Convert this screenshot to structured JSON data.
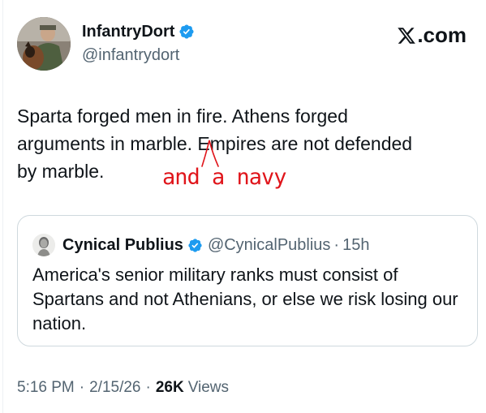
{
  "author": {
    "display_name": "InfantryDort",
    "handle": "@infantrydort",
    "verified": true
  },
  "brand": {
    "label": ".com",
    "logo_icon": "x-logo-icon"
  },
  "tweet": {
    "text": "Sparta forged men in fire. Athens forged\narguments in marble. Empires are not defended\nby marble."
  },
  "annotation": {
    "text": "and a navy",
    "color": "#e0151b"
  },
  "quoted": {
    "display_name": "Cynical Publius",
    "handle": "@CynicalPublius",
    "separator": "·",
    "time": "15h",
    "text": "America's senior military ranks must consist of Spartans and not Athenians, or else we risk losing our nation."
  },
  "meta": {
    "time": "5:16 PM",
    "date": "2/15/26",
    "separator": "·",
    "views_count": "26K",
    "views_label": "Views"
  },
  "colors": {
    "verified": "#1d9bf0",
    "secondary_text": "#536471",
    "border": "#cfd9de"
  }
}
